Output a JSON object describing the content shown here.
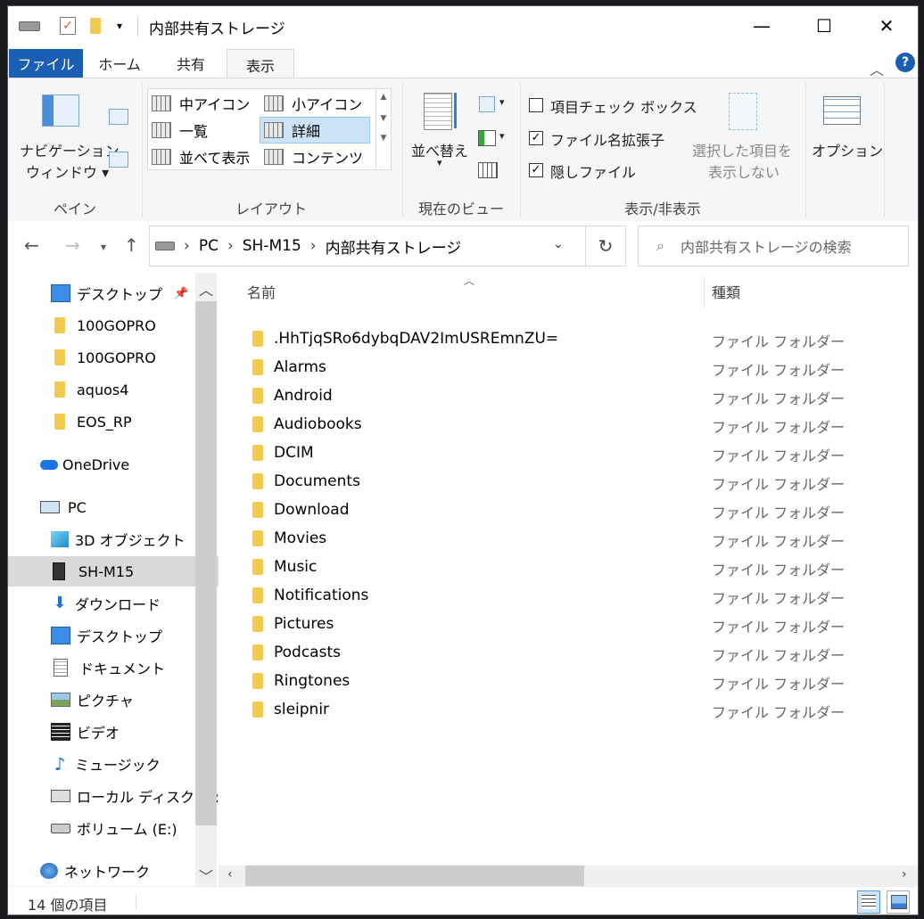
{
  "window": {
    "title": "内部共有ストレージ",
    "controls": {
      "minimize": "—",
      "maximize": "☐",
      "close": "✕"
    }
  },
  "ribbon": {
    "tabs": [
      {
        "label": "ファイル"
      },
      {
        "label": "ホーム"
      },
      {
        "label": "共有"
      },
      {
        "label": "表示"
      }
    ],
    "pane": {
      "nav_pane_label_1": "ナビゲーション",
      "nav_pane_label_2": "ウィンドウ ▾",
      "group_label": "ペイン"
    },
    "layout": {
      "items": [
        {
          "label": "中アイコン"
        },
        {
          "label": "小アイコン"
        },
        {
          "label": "一覧"
        },
        {
          "label": "詳細"
        },
        {
          "label": "並べて表示"
        },
        {
          "label": "コンテンツ"
        }
      ],
      "group_label": "レイアウト"
    },
    "current_view": {
      "sort_label": "並べ替え",
      "group_label": "現在のビュー"
    },
    "show_hide": {
      "item_checkboxes": "項目チェック ボックス",
      "file_extensions": "ファイル名拡張子",
      "hidden_items": "隠しファイル",
      "hide_selected_1": "選択した項目を",
      "hide_selected_2": "表示しない",
      "group_label": "表示/非表示"
    },
    "options_label": "オプション"
  },
  "address": {
    "root": "PC",
    "device": "SH-M15",
    "folder": "内部共有ストレージ",
    "search_placeholder": "内部共有ストレージの検索"
  },
  "nav_pane": {
    "items": [
      {
        "label": "デスクトップ"
      },
      {
        "label": "100GOPRO"
      },
      {
        "label": "100GOPRO"
      },
      {
        "label": "aquos4"
      },
      {
        "label": "EOS_RP"
      },
      {
        "label": "OneDrive"
      },
      {
        "label": "PC"
      },
      {
        "label": "3D オブジェクト"
      },
      {
        "label": "SH-M15"
      },
      {
        "label": "ダウンロード"
      },
      {
        "label": "デスクトップ"
      },
      {
        "label": "ドキュメント"
      },
      {
        "label": "ピクチャ"
      },
      {
        "label": "ビデオ"
      },
      {
        "label": "ミュージック"
      },
      {
        "label": "ローカル ディスク (C:)"
      },
      {
        "label": "ボリューム (E:)"
      },
      {
        "label": "ネットワーク"
      }
    ]
  },
  "content": {
    "columns": {
      "name": "名前",
      "type": "種類"
    },
    "rows": [
      {
        "name": ".HhTjqSRo6dybqDAV2ImUSREmnZU=",
        "type": "ファイル フォルダー"
      },
      {
        "name": "Alarms",
        "type": "ファイル フォルダー"
      },
      {
        "name": "Android",
        "type": "ファイル フォルダー"
      },
      {
        "name": "Audiobooks",
        "type": "ファイル フォルダー"
      },
      {
        "name": "DCIM",
        "type": "ファイル フォルダー"
      },
      {
        "name": "Documents",
        "type": "ファイル フォルダー"
      },
      {
        "name": "Download",
        "type": "ファイル フォルダー"
      },
      {
        "name": "Movies",
        "type": "ファイル フォルダー"
      },
      {
        "name": "Music",
        "type": "ファイル フォルダー"
      },
      {
        "name": "Notifications",
        "type": "ファイル フォルダー"
      },
      {
        "name": "Pictures",
        "type": "ファイル フォルダー"
      },
      {
        "name": "Podcasts",
        "type": "ファイル フォルダー"
      },
      {
        "name": "Ringtones",
        "type": "ファイル フォルダー"
      },
      {
        "name": "sleipnir",
        "type": "ファイル フォルダー"
      }
    ]
  },
  "status": {
    "count": "14 個の項目"
  }
}
